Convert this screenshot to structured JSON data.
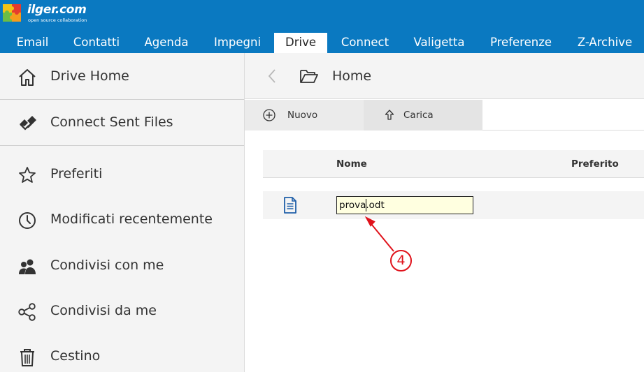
{
  "brand": {
    "name": "ilger.com",
    "tagline": "open source collaboration",
    "color": "#0a79c1"
  },
  "nav": {
    "tabs": [
      {
        "label": "Email"
      },
      {
        "label": "Contatti"
      },
      {
        "label": "Agenda"
      },
      {
        "label": "Impegni"
      },
      {
        "label": "Drive",
        "active": true
      },
      {
        "label": "Connect"
      },
      {
        "label": "Valigetta"
      },
      {
        "label": "Preferenze"
      },
      {
        "label": "Z-Archive"
      }
    ]
  },
  "sidebar": {
    "items": [
      {
        "label": "Drive Home",
        "icon": "home-icon"
      },
      {
        "label": "Connect Sent Files",
        "icon": "connect-icon"
      },
      {
        "label": "Preferiti",
        "icon": "star-icon"
      },
      {
        "label": "Modificati recentemente",
        "icon": "clock-icon"
      },
      {
        "label": "Condivisi con me",
        "icon": "users-icon"
      },
      {
        "label": "Condivisi da me",
        "icon": "share-icon"
      },
      {
        "label": "Cestino",
        "icon": "trash-icon"
      }
    ]
  },
  "main": {
    "breadcrumb": "Home",
    "toolbar": {
      "new_label": "Nuovo",
      "upload_label": "Carica"
    },
    "table": {
      "columns": [
        "Nome",
        "Preferito"
      ]
    },
    "file": {
      "name_value": "prova.odt",
      "icon": "document-icon"
    }
  },
  "annotation": {
    "step": "4",
    "color": "#e0121b"
  }
}
